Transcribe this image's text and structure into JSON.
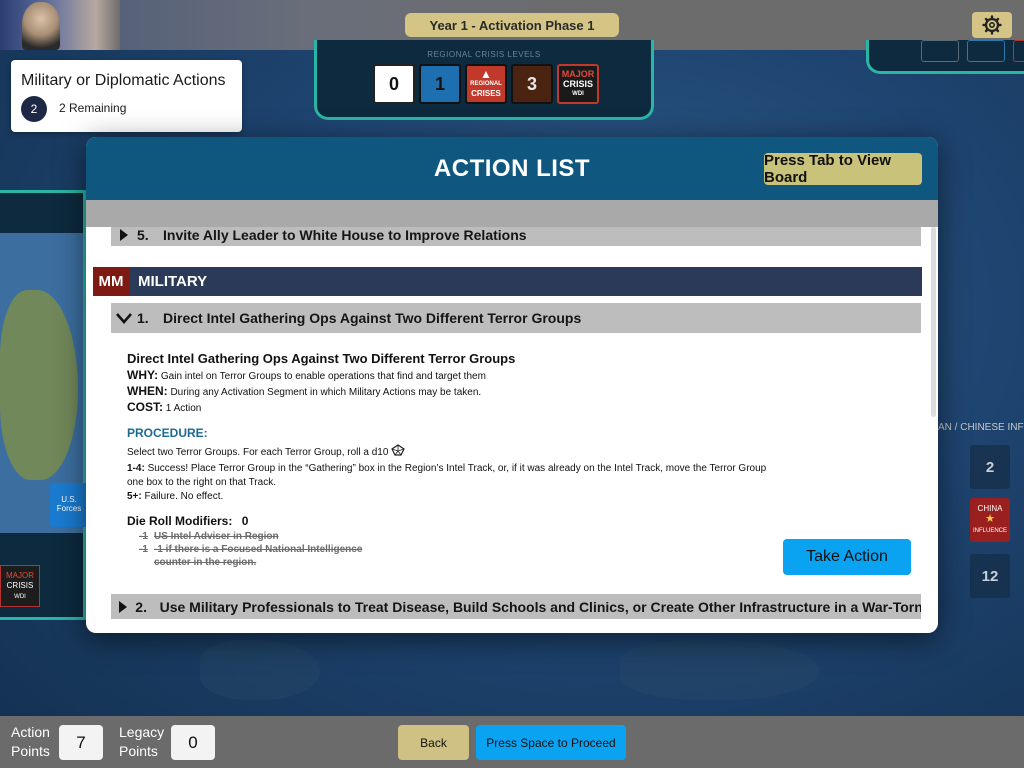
{
  "header": {
    "year_phase": "Year 1  -  Activation Phase 1"
  },
  "crisis_track": {
    "caption": "REGIONAL CRISIS LEVELS",
    "boxes": [
      {
        "label": "0"
      },
      {
        "label": "1"
      },
      {
        "label_top": "REGIONAL",
        "label_bottom": "CRISES"
      },
      {
        "label": "3"
      },
      {
        "label_top": "MAJOR",
        "label_mid": "CRISIS",
        "label_bottom": "WDI"
      }
    ],
    "colors": {
      "box0": "#ffffff",
      "box1": "#1d6fb0",
      "box2": "#c0392b",
      "box3": "#4a2410",
      "box4": "#1a1a1a"
    }
  },
  "action_card": {
    "title": "Military or Diplomatic Actions",
    "badge": "2",
    "remaining": "2 Remaining"
  },
  "board": {
    "us_forces_top": "U.S.",
    "us_forces_bottom": "Forces",
    "left_crisis_top": "MAJOR",
    "left_crisis_mid": "CRISIS",
    "left_crisis_bottom": "WDI",
    "right_label": "AN / CHINESE INFLU",
    "right_cells": [
      "2",
      "12"
    ],
    "china_top": "CHINA",
    "china_bottom": "INFLUENCE"
  },
  "modal": {
    "title": "ACTION LIST",
    "tab_button": "Press Tab to View Board",
    "prev_item": {
      "number": "5.",
      "label": "Invite Ally Leader to White House to Improve Relations"
    },
    "category": {
      "code": "MM",
      "name": "MILITARY"
    },
    "expanded_item": {
      "number": "1.",
      "label": "Direct Intel Gathering Ops Against Two Different Terror Groups"
    },
    "detail": {
      "title": "Direct Intel Gathering Ops Against Two Different Terror Groups",
      "why_key": "WHY:",
      "why": "Gain intel on Terror Groups to enable operations that find and target them",
      "when_key": "WHEN:",
      "when": "During any Activation Segment in which Military Actions may be taken.",
      "cost_key": "COST:",
      "cost": "1 Action",
      "procedure_heading": "PROCEDURE:",
      "procedure_intro": "Select two Terror Groups. For each Terror Group, roll a d10",
      "result1_key": "1-4:",
      "result1": "Success! Place Terror Group in the “Gathering” box in the Region’s Intel Track, or, if it was already on the Intel Track, move the Terror Group one box to the right on that Track.",
      "result2_key": "5+:",
      "result2": "Failure. No effect.",
      "modifiers_label": "Die Roll Modifiers:",
      "modifiers_value": "0",
      "modifier1_value": "-1",
      "modifier1": "US Intel Adviser in Region",
      "modifier2_value": "-1",
      "modifier2": "-1 if there is a Focused National Intelligence counter in the region."
    },
    "take_action": "Take Action",
    "next_item": {
      "number": "2.",
      "label": "Use Military Professionals to Treat Disease, Build Schools and Clinics, or Create Other Infrastructure in a War-Torn Region"
    }
  },
  "bottom_bar": {
    "action_points_label_1": "Action",
    "action_points_label_2": "Points",
    "action_points": "7",
    "legacy_points_label_1": "Legacy",
    "legacy_points_label_2": "Points",
    "legacy_points": "0",
    "back": "Back",
    "proceed": "Press Space to Proceed"
  },
  "colors": {
    "modal_header": "#10577f",
    "category_bar": "#2c3a5a",
    "category_code": "#7d1b13",
    "primary_button": "#0aa3f2",
    "gold_button": "#d4c586",
    "procedure_text": "#1c6a94"
  }
}
